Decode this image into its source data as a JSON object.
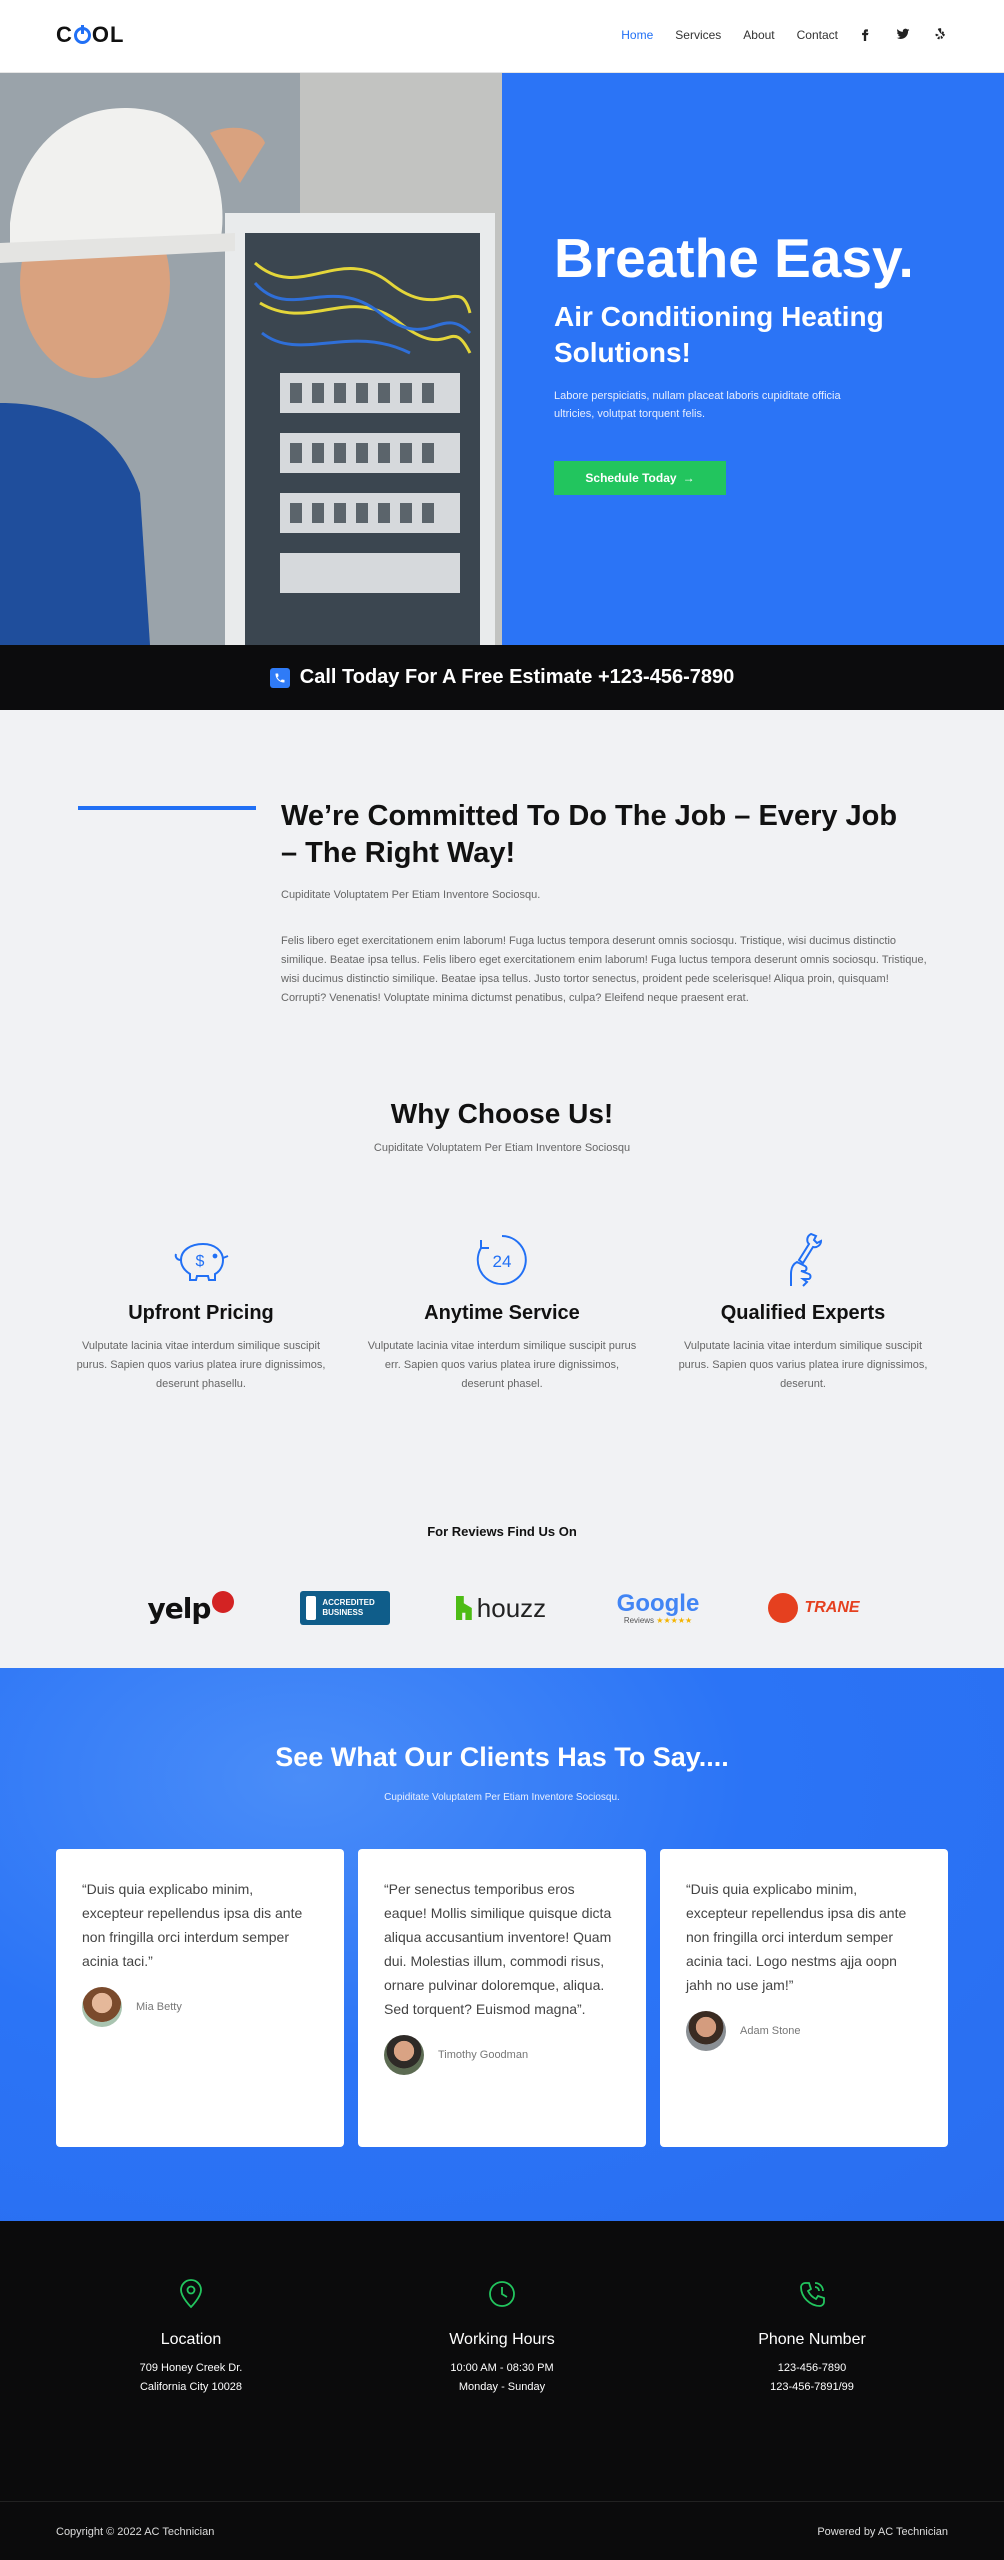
{
  "header": {
    "logo_text": "COOL",
    "nav": [
      "Home",
      "Services",
      "About",
      "Contact"
    ],
    "active_nav": "Home",
    "social_icons": [
      "facebook-icon",
      "twitter-icon",
      "yelp-icon"
    ]
  },
  "hero": {
    "title": "Breathe Easy.",
    "subtitle": "Air Conditioning Heating Solutions!",
    "text": "Labore perspiciatis, nullam placeat laboris cupiditate officia ultricies, volutpat torquent felis.",
    "button_label": "Schedule Today",
    "accent": "#2b74f6",
    "button_color": "#22c55e"
  },
  "callbar": {
    "text": "Call Today For A Free Estimate +123-456-7890"
  },
  "commit": {
    "title": "We’re Committed To Do The Job – Every Job – The Right Way!",
    "subtitle": "Cupiditate Voluptatem Per Etiam Inventore Sociosqu.",
    "body": "Felis libero eget exercitationem enim laborum! Fuga luctus tempora deserunt omnis sociosqu. Tristique, wisi ducimus distinctio similique. Beatae ipsa tellus. Felis libero eget exercitationem enim laborum! Fuga luctus tempora deserunt omnis sociosqu. Tristique, wisi ducimus distinctio similique. Beatae ipsa tellus. Justo tortor senectus, proident pede scelerisque! Aliqua proin, quisquam! Corrupti? Venenatis! Voluptate minima dictumst penatibus, culpa? Eleifend neque praesent erat."
  },
  "why": {
    "title": "Why Choose Us!",
    "subtitle": "Cupiditate Voluptatem Per Etiam Inventore Sociosqu",
    "features": [
      {
        "icon": "piggy-bank-icon",
        "title": "Upfront Pricing",
        "text": "Vulputate lacinia vitae interdum similique suscipit purus. Sapien quos varius platea irure dignissimos, deserunt phasellu."
      },
      {
        "icon": "clock-24-icon",
        "title": "Anytime Service",
        "text": "Vulputate lacinia vitae interdum similique suscipit purus err. Sapien quos varius platea irure dignissimos, deserunt phasel."
      },
      {
        "icon": "wrench-hand-icon",
        "title": "Qualified Experts",
        "text": "Vulputate lacinia vitae interdum similique suscipit purus. Sapien quos varius platea irure dignissimos, deserunt."
      }
    ]
  },
  "reviews": {
    "title": "For Reviews Find Us On",
    "logos": [
      {
        "name": "yelp-logo",
        "text": "yelp"
      },
      {
        "name": "bbb-logo",
        "text": "ACCREDITED BUSINESS"
      },
      {
        "name": "houzz-logo",
        "text": "houzz"
      },
      {
        "name": "google-reviews-logo",
        "text": "Google",
        "sub": "Reviews"
      },
      {
        "name": "trane-logo",
        "text": "TRANE"
      }
    ]
  },
  "testimonials": {
    "title": "See What Our Clients Has To Say....",
    "subtitle": "Cupiditate Voluptatem Per Etiam Inventore Sociosqu.",
    "items": [
      {
        "quote": "“Duis quia explicabo minim, excepteur repellendus ipsa dis ante non fringilla orci interdum semper acinia taci.”",
        "name": "Mia Betty"
      },
      {
        "quote": "“Per senectus temporibus eros eaque! Mollis similique quisque dicta aliqua accusantium inventore! Quam dui. Molestias illum, commodi risus, ornare pulvinar doloremque, aliqua. Sed torquent? Euismod magna”.",
        "name": "Timothy Goodman"
      },
      {
        "quote": "“Duis quia explicabo minim, excepteur repellendus ipsa dis ante non fringilla orci interdum semper acinia taci. Logo nestms ajja oopn jahh no use jam!”",
        "name": "Adam Stone"
      }
    ]
  },
  "contact": {
    "items": [
      {
        "icon": "map-pin-icon",
        "title": "Location",
        "line1": "709 Honey Creek Dr.",
        "line2": "California City 10028"
      },
      {
        "icon": "clock-icon",
        "title": "Working Hours",
        "line1": "10:00 AM - 08:30 PM",
        "line2": "Monday - Sunday"
      },
      {
        "icon": "phone-icon",
        "title": "Phone Number",
        "line1": "123-456-7890",
        "line2": "123-456-7891/99"
      }
    ],
    "icon_color": "#22c55e"
  },
  "footer": {
    "copyright": "Copyright © 2022 AC Technician",
    "powered": "Powered by AC Technician"
  }
}
